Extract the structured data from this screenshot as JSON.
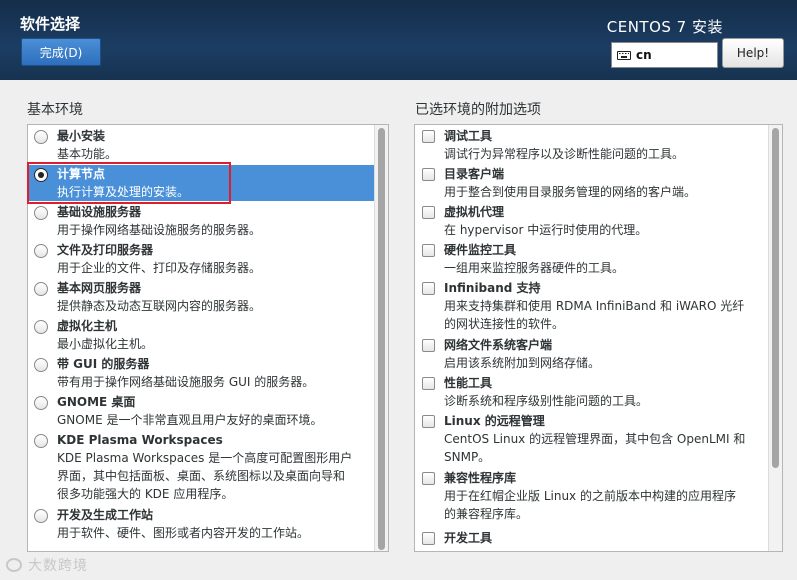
{
  "header": {
    "page_title": "软件选择",
    "done_label": "完成(D)",
    "product_title": "CENTOS 7 安装",
    "keyboard_layout": "cn",
    "help_label": "Help!"
  },
  "left_section_label": "基本环境",
  "right_section_label": "已选环境的附加选项",
  "environments": [
    {
      "name": "最小安装",
      "desc": [
        "基本功能。"
      ],
      "selected": false
    },
    {
      "name": "计算节点",
      "desc": [
        "执行计算及处理的安装。"
      ],
      "selected": true
    },
    {
      "name": "基础设施服务器",
      "desc": [
        "用于操作网络基础设施服务的服务器。"
      ],
      "selected": false
    },
    {
      "name": "文件及打印服务器",
      "desc": [
        "用于企业的文件、打印及存储服务器。"
      ],
      "selected": false
    },
    {
      "name": "基本网页服务器",
      "desc": [
        "提供静态及动态互联网内容的服务器。"
      ],
      "selected": false
    },
    {
      "name": "虚拟化主机",
      "desc": [
        "最小虚拟化主机。"
      ],
      "selected": false
    },
    {
      "name": "带 GUI 的服务器",
      "desc": [
        "带有用于操作网络基础设施服务 GUI 的服务器。"
      ],
      "selected": false
    },
    {
      "name": "GNOME 桌面",
      "desc": [
        "GNOME 是一个非常直观且用户友好的桌面环境。"
      ],
      "selected": false
    },
    {
      "name": "KDE Plasma Workspaces",
      "desc": [
        "KDE Plasma Workspaces 是一个高度可配置图形用户",
        "界面，其中包括面板、桌面、系统图标以及桌面向导和",
        "很多功能强大的 KDE 应用程序。"
      ],
      "selected": false
    },
    {
      "name": "开发及生成工作站",
      "desc": [
        "用于软件、硬件、图形或者内容开发的工作站。"
      ],
      "selected": false
    }
  ],
  "addons": [
    {
      "name": "调试工具",
      "desc": [
        "调试行为异常程序以及诊断性能问题的工具。"
      ],
      "checked": false
    },
    {
      "name": "目录客户端",
      "desc": [
        "用于整合到使用目录服务管理的网络的客户端。"
      ],
      "checked": false
    },
    {
      "name": "虚拟机代理",
      "desc": [
        "在 hypervisor 中运行时使用的代理。"
      ],
      "checked": false
    },
    {
      "name": "硬件监控工具",
      "desc": [
        "一组用来监控服务器硬件的工具。"
      ],
      "checked": false
    },
    {
      "name": "Infiniband 支持",
      "desc": [
        "用来支持集群和使用 RDMA InfiniBand 和 iWARO 光纤",
        "的网状连接性的软件。"
      ],
      "checked": false
    },
    {
      "name": "网络文件系统客户端",
      "desc": [
        "启用该系统附加到网络存储。"
      ],
      "checked": false
    },
    {
      "name": "性能工具",
      "desc": [
        "诊断系统和程序级别性能问题的工具。"
      ],
      "checked": false
    },
    {
      "name": "Linux 的远程管理",
      "desc": [
        "CentOS Linux 的远程管理界面，其中包含 OpenLMI 和",
        "SNMP。"
      ],
      "checked": false
    },
    {
      "name": "兼容性程序库",
      "desc": [
        "用于在红帽企业版 Linux 的之前版本中构建的应用程序",
        "的兼容程序库。"
      ],
      "checked": false
    },
    {
      "name": "开发工具",
      "desc": [],
      "checked": false
    }
  ],
  "watermark": "大数跨境"
}
